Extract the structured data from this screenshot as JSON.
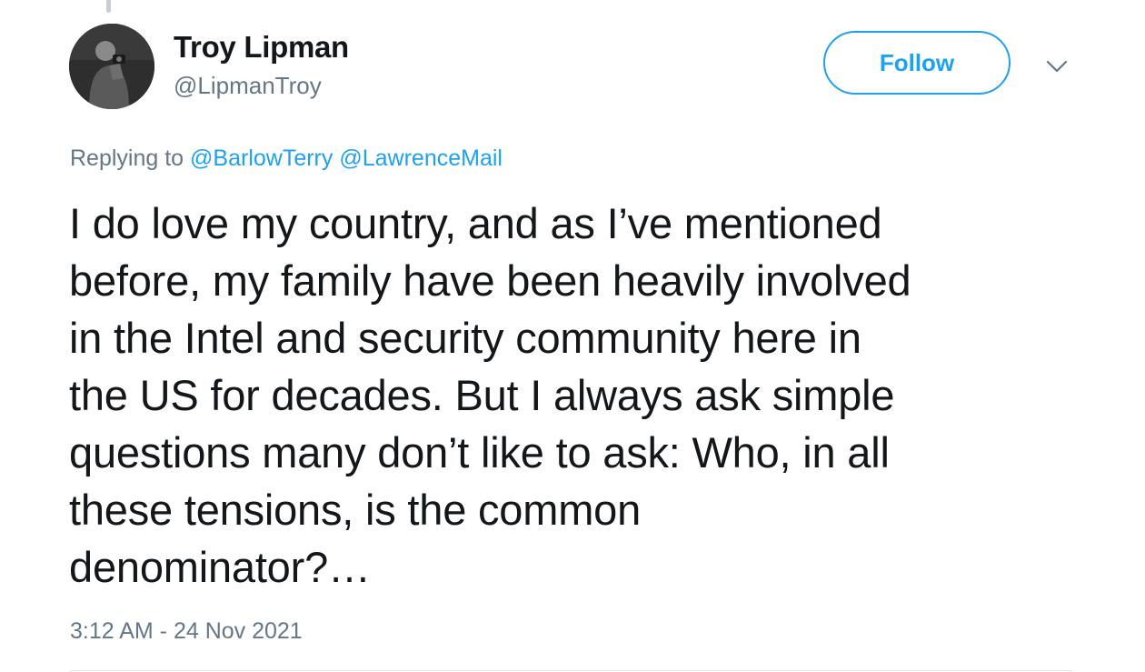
{
  "author": {
    "display_name": "Troy Lipman",
    "handle": "@LipmanTroy",
    "avatar": "profile-photo"
  },
  "actions": {
    "follow_label": "Follow",
    "menu_icon": "chevron-down-icon"
  },
  "reply": {
    "prefix": "Replying to",
    "mentions": [
      "@BarlowTerry",
      "@LawrenceMail"
    ]
  },
  "tweet": {
    "lines": [
      "I do love my country, and as I’ve mentioned",
      "before, my family have been heavily involved",
      "in the Intel and security community here in",
      "the US for decades. But I always ask simple",
      "questions many don’t like to ask: Who, in all",
      "these tensions, is the common",
      "denominator?…"
    ]
  },
  "timestamp": "3:12 AM - 24 Nov 2021",
  "colors": {
    "accent": "#1da1f2",
    "text_primary": "#14171a",
    "text_secondary": "#657786",
    "divider": "#e1e8ed"
  }
}
